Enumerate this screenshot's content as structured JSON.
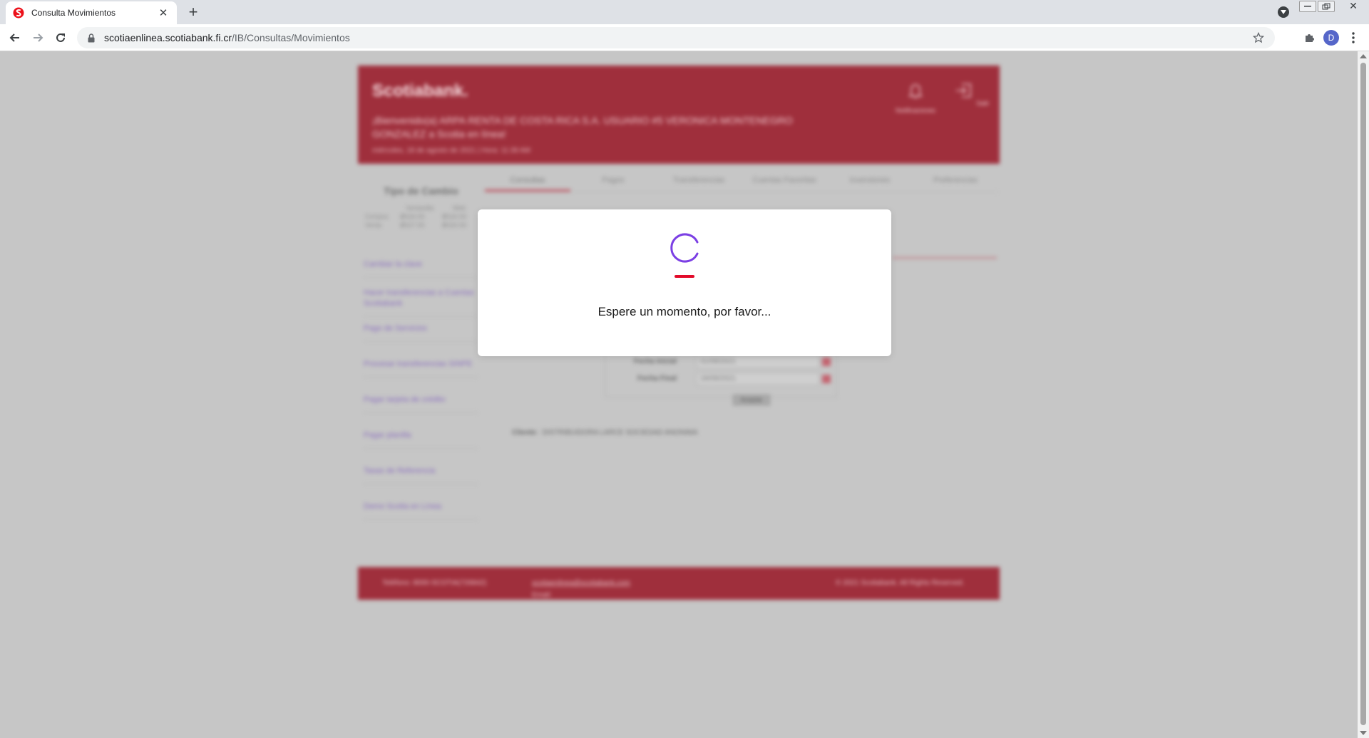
{
  "browser": {
    "tab_title": "Consulta Movimientos",
    "tab_close": "✕",
    "new_tab": "+",
    "url_host": "scotiaenlinea.scotiabank.fi.cr",
    "url_path": "/IB/Consultas/Movimientos",
    "profile_initial": "D",
    "window_close": "✕"
  },
  "colors": {
    "brand_red": "#ec111a",
    "header_red_dimmed": "#9f2f3c",
    "spinner_purple": "#7b3fe4",
    "spinner_bar_red": "#e20b2a"
  },
  "page": {
    "logo": "Scotiabank.",
    "welcome": "¡Bienvenido(a) ARPA RENTA DE COSTA RICA S.A. USUARIO #5 VERONICA MONTENEGRO GONZALEZ a Scotia en línea!",
    "date_line": "miércoles, 18 de agosto de 2021  |  Hora: 11:39 AM",
    "notifications_label": "Notificaciones",
    "exit_label": "Salir",
    "nav_tabs": [
      "Consultas",
      "Pagos",
      "Transferencias",
      "Cuentas Favoritas",
      "Inversiones",
      "Preferencias"
    ],
    "fx": {
      "title": "Tipo de Cambio",
      "col_ventanilla": "Ventanilla",
      "col_web": "Web",
      "buy_label": "Compra",
      "buy_ventanilla": "₡634.93",
      "buy_web": "₡634.93",
      "sell_label": "Venta",
      "sell_ventanilla": "₡627.93",
      "sell_web": "₡626.93"
    },
    "sidebar_links": [
      "Cambiar la clave",
      "Hacer transferencias a Cuentas Scotiabank",
      "Pago de Servicios",
      "Procesar transferencias SINPE",
      "Pagar tarjeta de crédito",
      "Pagar planilla",
      "Tasas de Referencia",
      "Demo Scotia en Línea"
    ],
    "form": {
      "start_label": "Fecha Inicial",
      "start_value": "01/08/2021",
      "end_label": "Fecha Final",
      "end_value": "18/08/2021",
      "accept_label": "Aceptar"
    },
    "client_label": "Cliente:",
    "client_value": "DISTRIBUIDORA LARCE SOCIEDAD ANONIMA",
    "footer": {
      "phone": "Teléfono: 8000-SCOTIA(726842)",
      "email_label": "Email:",
      "email": "scotiaenlinea@scotiabank.com",
      "copyright": "© 2021 Scotiabank. All Rights Reserved."
    }
  },
  "modal": {
    "message": "Espere un momento, por favor..."
  }
}
